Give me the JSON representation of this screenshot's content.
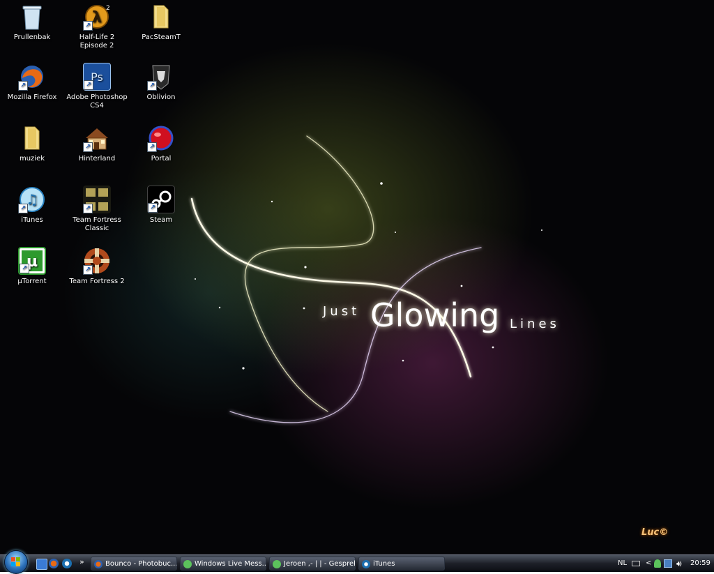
{
  "desktop_icons": [
    {
      "label": "Prullenbak",
      "icon": "recycle-bin-icon",
      "shortcut": false
    },
    {
      "label": "Half-Life 2 Episode 2",
      "icon": "half-life-icon",
      "shortcut": true
    },
    {
      "label": "PacSteamT",
      "icon": "folder-icon",
      "shortcut": false
    },
    {
      "label": "Mozilla Firefox",
      "icon": "firefox-icon",
      "shortcut": true
    },
    {
      "label": "Adobe Photoshop CS4",
      "icon": "photoshop-icon",
      "shortcut": true
    },
    {
      "label": "Oblivion",
      "icon": "oblivion-icon",
      "shortcut": true
    },
    {
      "label": "muziek",
      "icon": "folder-icon",
      "shortcut": false
    },
    {
      "label": "Hinterland",
      "icon": "hinterland-icon",
      "shortcut": true
    },
    {
      "label": "Portal",
      "icon": "portal-icon",
      "shortcut": true
    },
    {
      "label": "iTunes",
      "icon": "itunes-icon",
      "shortcut": true
    },
    {
      "label": "Team Fortress Classic",
      "icon": "tfc-icon",
      "shortcut": true
    },
    {
      "label": "Steam",
      "icon": "steam-icon",
      "shortcut": true
    },
    {
      "label": "µTorrent",
      "icon": "utorrent-icon",
      "shortcut": true
    },
    {
      "label": "Team Fortress 2",
      "icon": "tf2-icon",
      "shortcut": true
    }
  ],
  "wallpaper": {
    "just": "Just",
    "glowing": "Glowing",
    "lines": "Lines",
    "signature": "Luc©"
  },
  "taskbar": {
    "overflow_chevron": "»",
    "buttons": [
      {
        "label": "Bounco - Photobuc...",
        "icon": "firefox-icon"
      },
      {
        "label": "Windows Live Mess...",
        "icon": "messenger-icon"
      },
      {
        "label": "Jeroen ,- | | - Gesprek",
        "icon": "messenger-icon"
      },
      {
        "label": "iTunes",
        "icon": "itunes-icon"
      }
    ],
    "tray": {
      "language": "NL",
      "expand": "<",
      "clock": "20:59"
    }
  },
  "colors": {
    "photoshop": "#1b4f9c",
    "utorrent": "#2e9a2e",
    "tf2": "#b04a1c",
    "portal": "#d01020"
  }
}
